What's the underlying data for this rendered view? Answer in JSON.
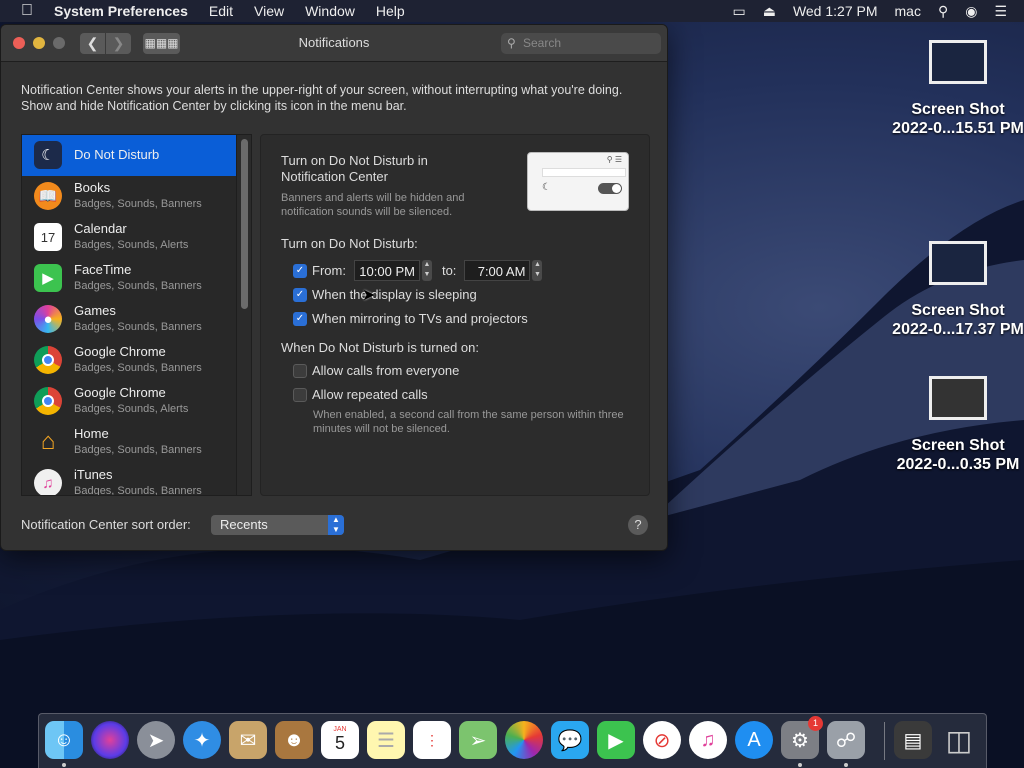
{
  "menubar": {
    "app_name": "System Preferences",
    "menus": [
      "Edit",
      "View",
      "Window",
      "Help"
    ],
    "clock": "Wed 1:27 PM",
    "user": "mac"
  },
  "window": {
    "title": "Notifications",
    "search_placeholder": "Search",
    "description": "Notification Center shows your alerts in the upper-right of your screen, without interrupting what you're doing. Show and hide Notification Center by clicking its icon in the menu bar.",
    "apps": [
      {
        "name": "Do Not Disturb",
        "sub": "",
        "selected": true,
        "icon": "moon-icon",
        "color": "#1c2a4a"
      },
      {
        "name": "Books",
        "sub": "Badges, Sounds, Banners",
        "icon": "book-icon",
        "color": "#f28a1c"
      },
      {
        "name": "Calendar",
        "sub": "Badges, Sounds, Alerts",
        "icon": "calendar-icon",
        "color": "#ffffff"
      },
      {
        "name": "FaceTime",
        "sub": "Badges, Sounds, Banners",
        "icon": "video-icon",
        "color": "#3cc34f"
      },
      {
        "name": "Games",
        "sub": "Badges, Sounds, Banners",
        "icon": "games-icon",
        "color": "#e0409a"
      },
      {
        "name": "Google Chrome",
        "sub": "Badges, Sounds, Banners",
        "icon": "chrome-icon",
        "color": "#db4437"
      },
      {
        "name": "Google Chrome",
        "sub": "Badges, Sounds, Alerts",
        "icon": "chrome-icon",
        "color": "#db4437"
      },
      {
        "name": "Home",
        "sub": "Badges, Sounds, Banners",
        "icon": "home-icon",
        "color": "#f5a623"
      },
      {
        "name": "iTunes",
        "sub": "Badges, Sounds, Banners",
        "icon": "music-icon",
        "color": "#f0f0f0"
      }
    ],
    "dnd": {
      "heading": "Turn on Do Not Disturb in Notification Center",
      "subtext": "Banners and alerts will be hidden and notification sounds will be silenced.",
      "turn_on_label": "Turn on Do Not Disturb:",
      "from_label": "From:",
      "from_time": "10:00 PM",
      "to_label": "to:",
      "to_time": "7:00 AM",
      "display_sleeping": "When the display is sleeping",
      "mirroring": "When mirroring to TVs and projectors",
      "when_on_label": "When Do Not Disturb is turned on:",
      "allow_calls": "Allow calls from everyone",
      "allow_repeated": "Allow repeated calls",
      "repeated_note": "When enabled, a second call from the same person within three minutes will not be silenced."
    },
    "sort_label": "Notification Center sort order:",
    "sort_value": "Recents",
    "help": "?"
  },
  "desktop": {
    "icons": [
      {
        "line1": "Screen Shot",
        "line2": "2022-0...15.51 PM"
      },
      {
        "line1": "Screen Shot",
        "line2": "2022-0...17.37 PM"
      },
      {
        "line1": "Screen Shot",
        "line2": "2022-0...0.35 PM"
      }
    ]
  },
  "dock": {
    "calendar_month": "JAN",
    "calendar_day": "5",
    "sysprefs_badge": "1"
  }
}
